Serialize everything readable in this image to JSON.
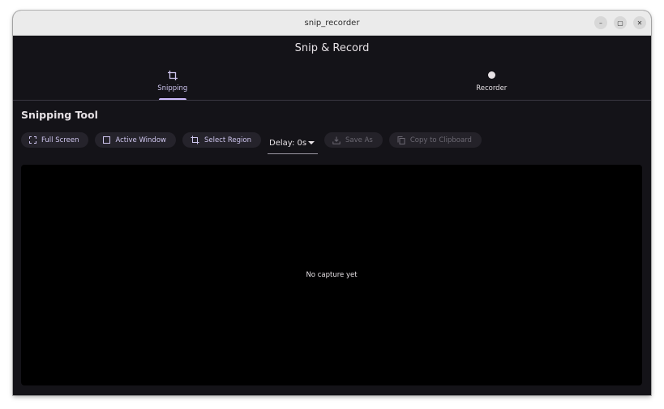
{
  "window": {
    "title": "snip_recorder",
    "controls": {
      "minimize": "–",
      "maximize": "▢",
      "close": "✕"
    }
  },
  "appbar": {
    "title": "Snip & Record"
  },
  "tabs": [
    {
      "label": "Snipping",
      "icon": "crop-icon",
      "active": true
    },
    {
      "label": "Recorder",
      "icon": "record-dot-icon",
      "active": false
    }
  ],
  "section": {
    "title": "Snipping Tool"
  },
  "toolbar": {
    "full_screen": "Full Screen",
    "active_window": "Active Window",
    "select_region": "Select Region",
    "delay": "Delay: 0s",
    "save_as": "Save As",
    "copy_to_clipboard": "Copy to Clipboard"
  },
  "capture": {
    "placeholder": "No capture yet"
  },
  "colors": {
    "background": "#141318",
    "accent": "#cfbdfe",
    "button_bg": "#25232b",
    "disabled_text": "#6b6872"
  }
}
